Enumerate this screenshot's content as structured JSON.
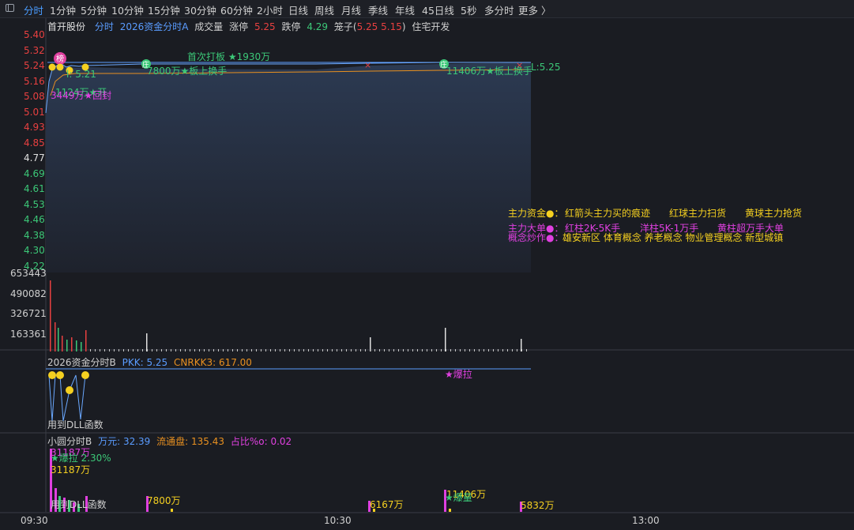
{
  "tabs": [
    {
      "label": "分时",
      "active": true
    },
    {
      "label": "1分钟"
    },
    {
      "label": "5分钟"
    },
    {
      "label": "10分钟"
    },
    {
      "label": "15分钟"
    },
    {
      "label": "30分钟"
    },
    {
      "label": "60分钟"
    },
    {
      "label": "2小时"
    },
    {
      "label": "日线"
    },
    {
      "label": "周线"
    },
    {
      "label": "月线"
    },
    {
      "label": "季线"
    },
    {
      "label": "年线"
    },
    {
      "label": "45日线"
    },
    {
      "label": "5秒"
    },
    {
      "label": "多分时"
    },
    {
      "label": "更多 〉"
    }
  ],
  "header": {
    "stock_name": "首开股份",
    "mode": "分时",
    "indicator": "2026资金分时A",
    "vol_label": "成交量",
    "zt_label": "涨停",
    "zt_value": "5.25",
    "dt_label": "跌停",
    "dt_value": "4.29",
    "cage_label": "笼子(",
    "cage_high": "5.25",
    "cage_low": "5.15",
    "cage_close": ")",
    "sector": "住宅开发"
  },
  "price_axis": [
    {
      "v": "5.40",
      "c": "red"
    },
    {
      "v": "5.32",
      "c": "red"
    },
    {
      "v": "5.24",
      "c": "red"
    },
    {
      "v": "5.16",
      "c": "red"
    },
    {
      "v": "5.08",
      "c": "red"
    },
    {
      "v": "5.01",
      "c": "red"
    },
    {
      "v": "4.93",
      "c": "red"
    },
    {
      "v": "4.85",
      "c": "red"
    },
    {
      "v": "4.77",
      "c": "white"
    },
    {
      "v": "4.69",
      "c": "green"
    },
    {
      "v": "4.61",
      "c": "green"
    },
    {
      "v": "4.53",
      "c": "green"
    },
    {
      "v": "4.46",
      "c": "green"
    },
    {
      "v": "4.38",
      "c": "green"
    },
    {
      "v": "4.30",
      "c": "green"
    },
    {
      "v": "4.22",
      "c": "green"
    }
  ],
  "volume_axis": [
    "653443",
    "490082",
    "326721",
    "163361"
  ],
  "annotations": {
    "badge_zt": "榜",
    "first_board": "首次打板 ★1930万",
    "board_swap_1": "7800万★板上换手",
    "board_swap_2": "11406万★板上换手",
    "l_value": "L:5.25",
    "small_left_1": "l: 5.21",
    "small_left_2": "1124万★开",
    "small_left_3": "3449万★回封",
    "marker_ting": "庄"
  },
  "legend": {
    "row1_title": "主力资金●：",
    "row1_items": [
      "红箭头主力买的痕迹",
      "红球主力扫货",
      "黄球主力抢货"
    ],
    "row2_title": "主力大单●：",
    "row2_items": [
      "红柱2K-5K手",
      "洋柱5K-1万手",
      "黄柱超万手大单"
    ],
    "row3_title": "概念炒作●：",
    "row3_items": "雄安新区 体育概念 养老概念 物业管理概念 新型城镇"
  },
  "panel_b": {
    "title": "2026资金分时B",
    "pkk_label": "PKK:",
    "pkk_value": "5.25",
    "cnr_label": "CNRKK3:",
    "cnr_value": "617.00",
    "baola": "★爆拉",
    "dll": "用到DLL函数"
  },
  "panel_c": {
    "title": "小圆分时B",
    "wy_label": "万元:",
    "wy_value": "32.39",
    "ltp_label": "流通盘:",
    "ltp_value": "135.43",
    "zb_label": "占比%o:",
    "zb_value": "0.02",
    "label_a": "31187万",
    "label_b": "★爆拉 2.30%",
    "label_c": "31187万",
    "label_d": "7800万",
    "label_e": "6167万",
    "label_f": "11406万",
    "label_g": "★爆量",
    "label_h": "5832万",
    "dll": "用到DLL函数"
  },
  "time_axis": [
    "09:30",
    "10:30",
    "13:00"
  ],
  "colors": {
    "red": "#e84040",
    "green": "#3cc878",
    "yellow": "#f5d020",
    "magenta": "#e040e0",
    "blue": "#5a9cff",
    "orange": "#e89020"
  }
}
